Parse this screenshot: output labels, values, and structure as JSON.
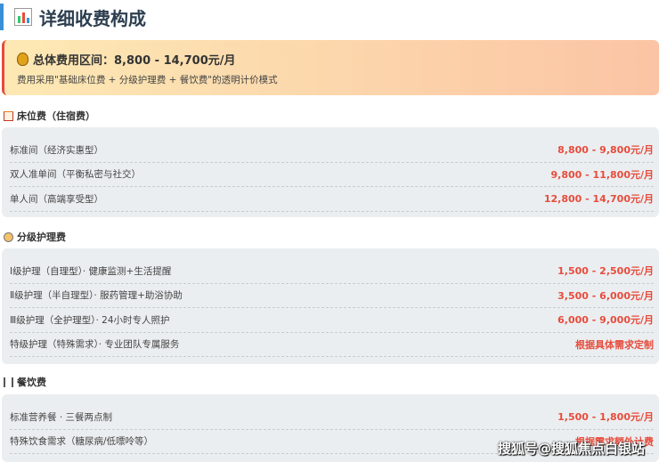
{
  "title": "详细收费构成",
  "summary": {
    "label": "总体费用区间：8,800 - 14,700元/月",
    "desc": "费用采用\"基础床位费 + 分级护理费 + 餐饮费\"的透明计价模式"
  },
  "sections": [
    {
      "title": "床位费（住宿费）",
      "rows": [
        {
          "name": "标准间（经济实惠型）",
          "price": "8,800 - 9,800元/月"
        },
        {
          "name": "双人准单间（平衡私密与社交）",
          "price": "9,800 - 11,800元/月"
        },
        {
          "name": "单人间（高端享受型）",
          "price": "12,800 - 14,700元/月"
        }
      ]
    },
    {
      "title": "分级护理费",
      "rows": [
        {
          "name": "Ⅰ级护理（自理型）· 健康监测+生活提醒",
          "price": "1,500 - 2,500元/月"
        },
        {
          "name": "Ⅱ级护理（半自理型）· 服药管理+助浴协助",
          "price": "3,500 - 6,000元/月"
        },
        {
          "name": "Ⅲ级护理（全护理型）· 24小时专人照护",
          "price": "6,000 - 9,000元/月"
        },
        {
          "name": "特级护理（特殊需求）· 专业团队专属服务",
          "price": "根据具体需求定制"
        }
      ]
    },
    {
      "title": "餐饮费",
      "rows": [
        {
          "name": "标准营养餐 · 三餐两点制",
          "price": "1,500 - 1,800元/月"
        },
        {
          "name": "特殊饮食需求（糖尿病/低嘌呤等）",
          "price": "根据需求额外计费"
        }
      ]
    }
  ],
  "watermark": "搜狐号@搜狐焦点白银站"
}
